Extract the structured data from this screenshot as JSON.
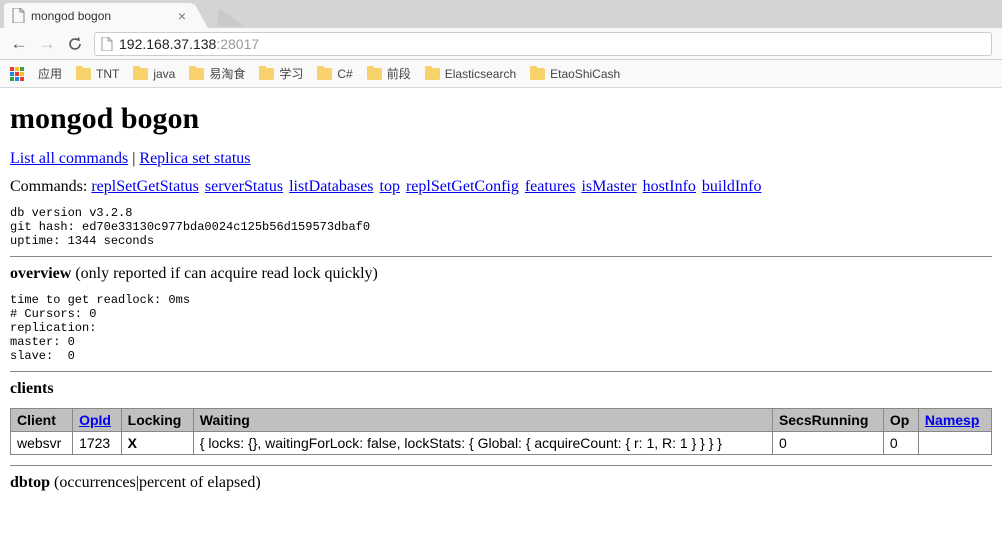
{
  "browser": {
    "tab_title": "mongod bogon",
    "url": {
      "host": "192.168.37.138",
      "port": ":28017"
    },
    "bookmarks": {
      "apps_label": "应用",
      "items": [
        "TNT",
        "java",
        "易淘食",
        "学习",
        "C#",
        "前段",
        "Elasticsearch",
        "EtaoShiCash"
      ]
    }
  },
  "page": {
    "h1": "mongod bogon",
    "top_links": {
      "list_all": "List all commands",
      "sep": " | ",
      "replica": "Replica set status"
    },
    "commands_label": "Commands: ",
    "commands": [
      "replSetGetStatus",
      "serverStatus",
      "listDatabases",
      "top",
      "replSetGetConfig",
      "features",
      "isMaster",
      "hostInfo",
      "buildInfo"
    ],
    "version_block": "db version v3.2.8\ngit hash: ed70e33130c977bda0024c125b56d159573dbaf0\nuptime: 1344 seconds",
    "overview": {
      "title": "overview",
      "sub": " (only reported if can acquire read lock quickly)"
    },
    "overview_block": "time to get readlock: 0ms\n# Cursors: 0\nreplication:\nmaster: 0\nslave:  0",
    "clients": {
      "title": "clients",
      "headers": {
        "client": "Client",
        "opid": "OpId",
        "locking": "Locking",
        "waiting": "Waiting",
        "secs": "SecsRunning",
        "op": "Op",
        "ns": "Namesp"
      },
      "row": {
        "client": "websvr",
        "opid": "1723",
        "locking": "X",
        "waiting": "{ locks: {}, waitingForLock: false, lockStats: { Global: { acquireCount: { r: 1, R: 1 } } } }",
        "secs": "0",
        "op": "0",
        "ns": ""
      }
    },
    "dbtop": {
      "title": "dbtop",
      "sub": " (occurrences|percent of elapsed)"
    }
  }
}
